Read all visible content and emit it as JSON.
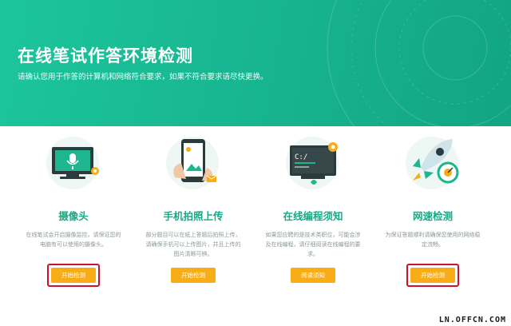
{
  "header": {
    "title": "在线笔试作答环境检测",
    "subtitle": "请确认您用于作答的计算机和网络符合要求，如果不符合要求请尽快更换。"
  },
  "cards": [
    {
      "icon": "webcam-icon",
      "title": "摄像头",
      "description": "在线笔试会开启摄像监控，请保证您的电脑有可以使用的摄像头。",
      "button": "开始检测",
      "highlighted": true
    },
    {
      "icon": "phone-photo-icon",
      "title": "手机拍照上传",
      "description": "部分题目可以在纸上答题后拍照上传，请确保手机可以上传图片，并且上传的图片清晰可辨。",
      "button": "开始检测",
      "highlighted": false
    },
    {
      "icon": "code-editor-icon",
      "title": "在线编程须知",
      "description": "如果您应聘的是技术类职位，可能会涉及在线编程，请仔细阅读在线编程的要求。",
      "button": "阅读须知",
      "highlighted": false
    },
    {
      "icon": "rocket-speed-icon",
      "title": "网速检测",
      "description": "为保证答题顺利请确保您使用的网络稳定流畅。",
      "button": "开始检测",
      "highlighted": true
    }
  ],
  "watermark": "LN.OFFCN.COM",
  "colors": {
    "brand": "#17b38f",
    "title_green": "#18a985",
    "button": "#f8ac16",
    "highlight_border": "#d0112b"
  }
}
